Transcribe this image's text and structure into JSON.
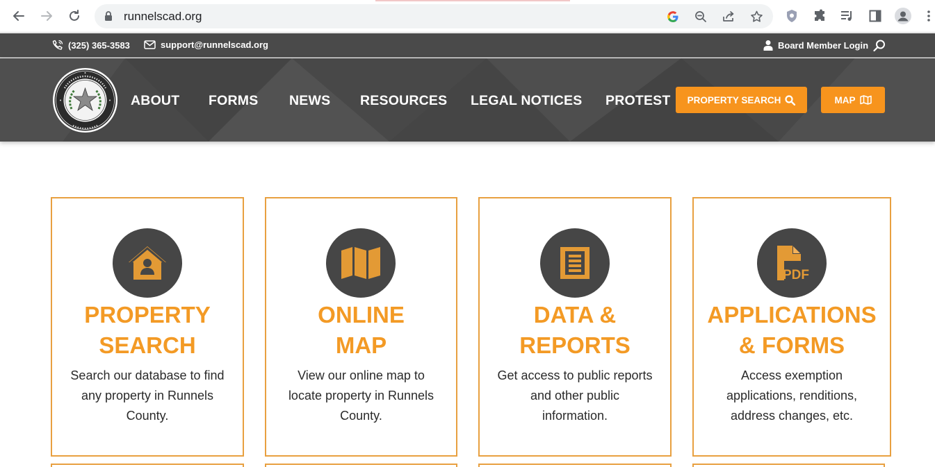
{
  "browser": {
    "url": "runnelscad.org"
  },
  "topbar": {
    "phone": "(325) 365-3583",
    "email": "support@runnelscad.org",
    "login": "Board Member Login"
  },
  "nav": {
    "items": [
      "ABOUT",
      "FORMS",
      "NEWS",
      "RESOURCES",
      "LEGAL NOTICES",
      "PROTEST"
    ],
    "property_search": "PROPERTY SEARCH",
    "map": "MAP"
  },
  "cards": [
    {
      "icon": "house-user-icon",
      "title_line1": "PROPERTY",
      "title_line2": "SEARCH",
      "desc_lines": [
        "Search our database to find",
        "any property in Runnels",
        "County."
      ]
    },
    {
      "icon": "map-icon",
      "title_line1": "ONLINE",
      "title_line2": "MAP",
      "desc_lines": [
        "View our online map to",
        "locate property in Runnels",
        "County."
      ]
    },
    {
      "icon": "document-icon",
      "title_line1": "DATA &",
      "title_line2": "REPORTS",
      "desc_lines": [
        "Get access to public reports",
        "and other public",
        "information."
      ]
    },
    {
      "icon": "pdf-icon",
      "title_line1": "APPLICATIONS",
      "title_line2": "& FORMS",
      "desc_lines": [
        "Access exemption",
        "applications, renditions,",
        "address changes, etc."
      ]
    }
  ],
  "colors": {
    "accent": "#f7941d",
    "title_orange": "#f39a25",
    "header_bg": "#484848",
    "card_border": "#e8a040"
  }
}
